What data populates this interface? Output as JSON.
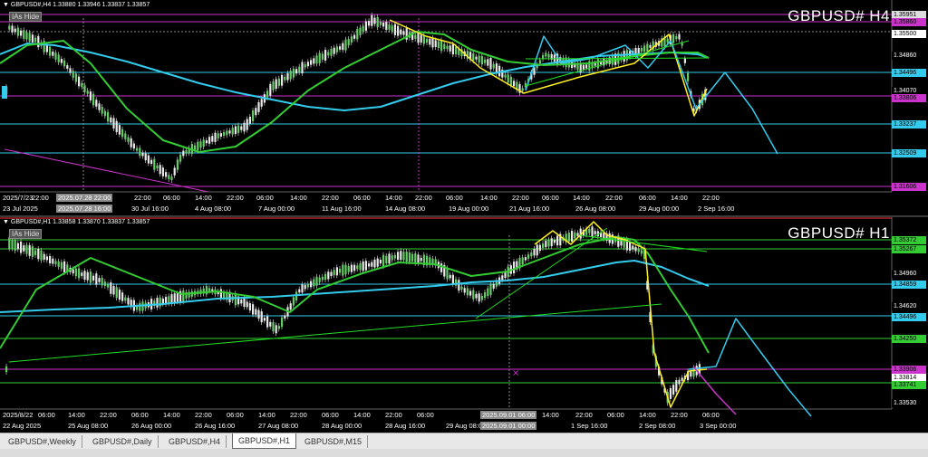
{
  "h4": {
    "header": "▼ GBPUSD#,H4  1.33880 1.33946 1.33837 1.33857",
    "as_hide": "IAs Hide",
    "symbol": "GBPUSD#  H4",
    "price_labels": [
      {
        "text": "1.35951",
        "bg": "#dddddd",
        "fg": "#000"
      },
      {
        "text": "1.35860",
        "bg": "#cc33cc",
        "fg": "#000"
      },
      {
        "text": "1.35500",
        "bg": "#ffffff",
        "fg": "#000"
      },
      {
        "text": "1.34860",
        "bg": "#000000",
        "fg": "#ffffff"
      },
      {
        "text": "1.34496",
        "bg": "#33ccee",
        "fg": "#000"
      },
      {
        "text": "1.34070",
        "bg": "#000000",
        "fg": "#ffffff"
      },
      {
        "text": "1.33806",
        "bg": "#cc33cc",
        "fg": "#000"
      },
      {
        "text": "1.33237",
        "bg": "#33ccee",
        "fg": "#000"
      },
      {
        "text": "1.32509",
        "bg": "#33ccee",
        "fg": "#000"
      },
      {
        "text": "1.31606",
        "bg": "#cc33cc",
        "fg": "#000"
      }
    ],
    "time_labels": [
      {
        "text": "2025/7/23",
        "hl": false
      },
      {
        "text": "22:00",
        "hl": false
      },
      {
        "text": "2025.07.28 22:00",
        "hl": true
      },
      {
        "text": "22:00",
        "hl": false
      },
      {
        "text": "06:00",
        "hl": false
      },
      {
        "text": "14:00",
        "hl": false
      },
      {
        "text": "22:00",
        "hl": false
      },
      {
        "text": "06:00",
        "hl": false
      },
      {
        "text": "14:00",
        "hl": false
      },
      {
        "text": "22:00",
        "hl": false
      },
      {
        "text": "06:00",
        "hl": false
      },
      {
        "text": "14:00",
        "hl": false
      },
      {
        "text": "22:00",
        "hl": false
      },
      {
        "text": "06:00",
        "hl": false
      },
      {
        "text": "14:00",
        "hl": false
      },
      {
        "text": "22:00",
        "hl": false
      },
      {
        "text": "06:00",
        "hl": false
      },
      {
        "text": "14:00",
        "hl": false
      },
      {
        "text": "22:00",
        "hl": false
      },
      {
        "text": "06:00",
        "hl": false
      },
      {
        "text": "14:00",
        "hl": false
      },
      {
        "text": "22:00",
        "hl": false
      }
    ],
    "date_labels": [
      {
        "text": "23 Jul 2025",
        "hl": false
      },
      {
        "text": "2025.07.28 16:00",
        "hl": true
      },
      {
        "text": "30 Jul 16:00",
        "hl": false
      },
      {
        "text": "4 Aug 08:00",
        "hl": false
      },
      {
        "text": "7 Aug 00:00",
        "hl": false
      },
      {
        "text": "11 Aug 16:00",
        "hl": false
      },
      {
        "text": "14 Aug 08:00",
        "hl": false
      },
      {
        "text": "19 Aug 00:00",
        "hl": false
      },
      {
        "text": "21 Aug 16:00",
        "hl": false
      },
      {
        "text": "26 Aug 08:00",
        "hl": false
      },
      {
        "text": "29 Aug 00:00",
        "hl": false
      },
      {
        "text": "2 Sep 16:00",
        "hl": false
      }
    ]
  },
  "h1": {
    "header": "▼ GBPUSD#,H1  1.33858 1.33870 1.33837 1.33857",
    "as_hide": "IAs Hide",
    "symbol": "GBPUSD#  H1",
    "price_labels": [
      {
        "text": "1.35372",
        "bg": "#33cc33",
        "fg": "#000"
      },
      {
        "text": "1.35267",
        "bg": "#33cc33",
        "fg": "#000"
      },
      {
        "text": "1.34960",
        "bg": "#000000",
        "fg": "#ffffff"
      },
      {
        "text": "1.34859",
        "bg": "#33ccee",
        "fg": "#000"
      },
      {
        "text": "1.34620",
        "bg": "#000000",
        "fg": "#ffffff"
      },
      {
        "text": "1.34496",
        "bg": "#33ccee",
        "fg": "#000"
      },
      {
        "text": "1.34250",
        "bg": "#33cc33",
        "fg": "#000"
      },
      {
        "text": "1.33906",
        "bg": "#cc33cc",
        "fg": "#000"
      },
      {
        "text": "1.33814",
        "bg": "#ffffff",
        "fg": "#000"
      },
      {
        "text": "1.33741",
        "bg": "#33cc33",
        "fg": "#000"
      },
      {
        "text": "1.33530",
        "bg": "#000000",
        "fg": "#ffffff"
      }
    ],
    "time_labels": [
      {
        "text": "2025/8/22",
        "hl": false
      },
      {
        "text": "06:00",
        "hl": false
      },
      {
        "text": "14:00",
        "hl": false
      },
      {
        "text": "22:00",
        "hl": false
      },
      {
        "text": "06:00",
        "hl": false
      },
      {
        "text": "14:00",
        "hl": false
      },
      {
        "text": "22:00",
        "hl": false
      },
      {
        "text": "06:00",
        "hl": false
      },
      {
        "text": "14:00",
        "hl": false
      },
      {
        "text": "22:00",
        "hl": false
      },
      {
        "text": "06:00",
        "hl": false
      },
      {
        "text": "14:00",
        "hl": false
      },
      {
        "text": "22:00",
        "hl": false
      },
      {
        "text": "06:00",
        "hl": false
      },
      {
        "text": "2025.09.01 06:00",
        "hl": true
      },
      {
        "text": "14:00",
        "hl": false
      },
      {
        "text": "22:00",
        "hl": false
      },
      {
        "text": "06:00",
        "hl": false
      },
      {
        "text": "14:00",
        "hl": false
      },
      {
        "text": "22:00",
        "hl": false
      },
      {
        "text": "06:00",
        "hl": false
      }
    ],
    "date_labels": [
      {
        "text": "22 Aug 2025",
        "hl": false
      },
      {
        "text": "25 Aug 08:00",
        "hl": false
      },
      {
        "text": "26 Aug 00:00",
        "hl": false
      },
      {
        "text": "26 Aug 16:00",
        "hl": false
      },
      {
        "text": "27 Aug 08:00",
        "hl": false
      },
      {
        "text": "28 Aug 00:00",
        "hl": false
      },
      {
        "text": "28 Aug 16:00",
        "hl": false
      },
      {
        "text": "29 Aug 08:00",
        "hl": false
      },
      {
        "text": "2025.09.01 00:00",
        "hl": true
      },
      {
        "text": "1 Sep 16:00",
        "hl": false
      },
      {
        "text": "2 Sep 08:00",
        "hl": false
      },
      {
        "text": "3 Sep 00:00",
        "hl": false
      }
    ]
  },
  "tabs": [
    {
      "label": "GBPUSD#,Weekly",
      "active": false
    },
    {
      "label": "GBPUSD#,Daily",
      "active": false
    },
    {
      "label": "GBPUSD#,H4",
      "active": false
    },
    {
      "label": "GBPUSD#,H1",
      "active": true
    },
    {
      "label": "GBPUSD#,M15",
      "active": false
    }
  ],
  "colors": {
    "cyan": "#33ccee",
    "green": "#33cc33",
    "yellow": "#ffee22",
    "magenta": "#cc33cc",
    "lime": "#22dd22"
  }
}
